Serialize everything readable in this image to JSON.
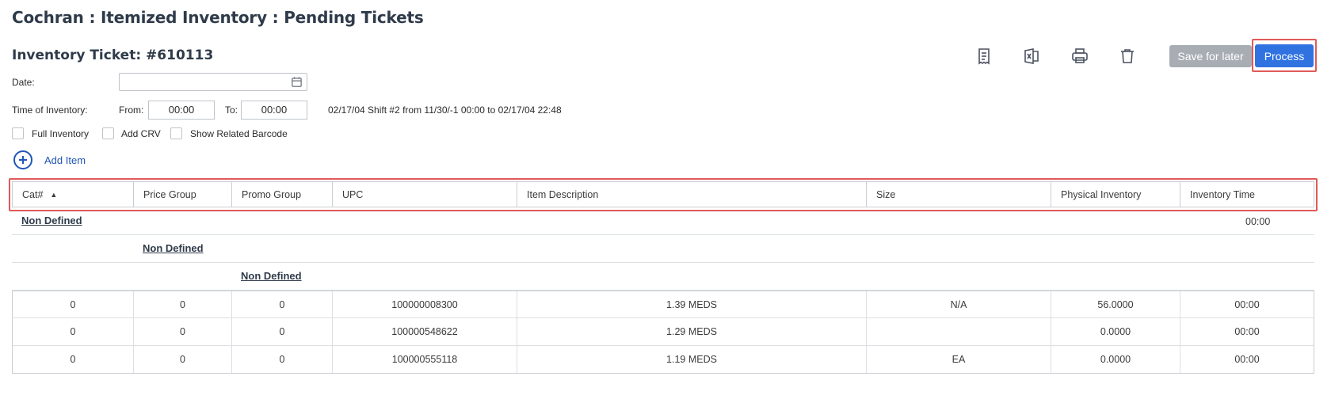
{
  "page": {
    "title": "Cochran : Itemized Inventory : Pending Tickets",
    "ticket_title": "Inventory Ticket: #610113"
  },
  "toolbar": {
    "icons": [
      "receipt-icon",
      "excel-icon",
      "print-icon",
      "trash-icon"
    ],
    "save_label": "Save for later",
    "process_label": "Process"
  },
  "form": {
    "date_label": "Date:",
    "date_value": "",
    "time_label": "Time of Inventory:",
    "from_label": "From:",
    "from_value": "00:00",
    "to_label": "To:",
    "to_value": "00:00",
    "shift_text": "02/17/04 Shift #2 from 11/30/-1 00:00 to 02/17/04 22:48",
    "checkboxes": [
      {
        "label": "Full Inventory",
        "checked": false
      },
      {
        "label": "Add CRV",
        "checked": false
      },
      {
        "label": "Show Related Barcode",
        "checked": false
      }
    ],
    "add_item_label": "Add Item"
  },
  "table": {
    "headers": [
      "Cat#",
      "Price Group",
      "Promo Group",
      "UPC",
      "Item Description",
      "Size",
      "Physical Inventory",
      "Inventory Time"
    ],
    "sort_indicator": "▲",
    "groups": [
      {
        "label": "Non Defined",
        "time": "00:00"
      },
      {
        "label": "Non Defined"
      },
      {
        "label": "Non Defined"
      }
    ],
    "rows": [
      [
        "0",
        "0",
        "0",
        "100000008300",
        "1.39 MEDS",
        "N/A",
        "56.0000",
        "00:00"
      ],
      [
        "0",
        "0",
        "0",
        "100000548622",
        "1.29 MEDS",
        "",
        "0.0000",
        "00:00"
      ],
      [
        "0",
        "0",
        "0",
        "100000555118",
        "1.19 MEDS",
        "EA",
        "0.0000",
        "00:00"
      ]
    ]
  },
  "colors": {
    "accent": "#2f72e0",
    "highlight": "#e05a5a",
    "disabled": "#a8adb4",
    "link": "#2156b8"
  }
}
